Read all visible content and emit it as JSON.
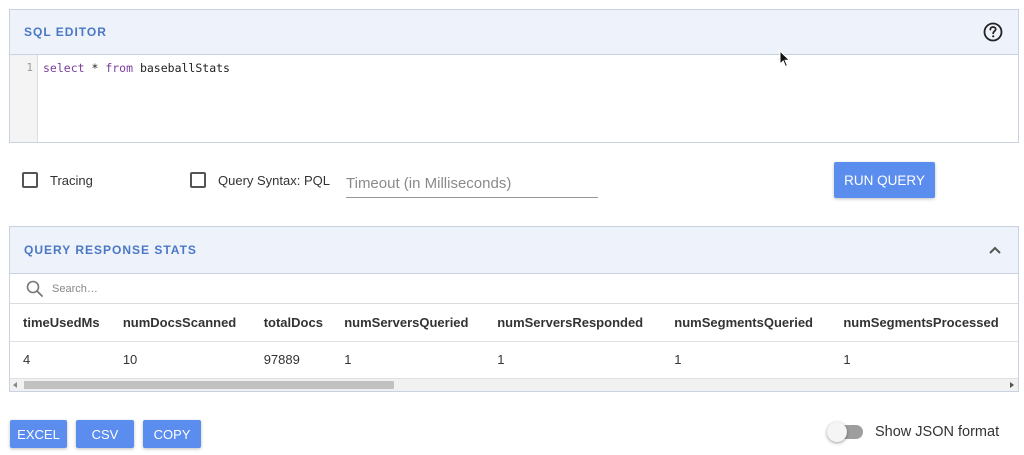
{
  "sql_editor": {
    "title": "SQL EDITOR",
    "help_icon": "help-circle-icon",
    "line_number": "1",
    "query_keyword_1": "select",
    "query_star": " * ",
    "query_keyword_2": "from",
    "query_table": " baseballStats"
  },
  "controls": {
    "tracing_label": "Tracing",
    "tracing_checked": false,
    "pql_label": "Query Syntax: PQL",
    "pql_checked": false,
    "timeout_placeholder": "Timeout (in Milliseconds)",
    "timeout_value": "",
    "run_label": "RUN QUERY"
  },
  "stats": {
    "title": "QUERY RESPONSE STATS",
    "collapse_icon": "chevron-up-icon",
    "search_placeholder": "Search…",
    "columns": [
      "timeUsedMs",
      "numDocsScanned",
      "totalDocs",
      "numServersQueried",
      "numServersResponded",
      "numSegmentsQueried",
      "numSegmentsProcessed"
    ],
    "rows": [
      [
        "4",
        "10",
        "97889",
        "1",
        "1",
        "1",
        "1"
      ]
    ]
  },
  "footer": {
    "excel_label": "EXCEL",
    "csv_label": "CSV",
    "copy_label": "COPY",
    "json_toggle_label": "Show JSON format",
    "json_toggle_on": false
  },
  "colors": {
    "accent": "#5b8def",
    "header_bg": "#eef2fa",
    "title_text": "#4a78c6"
  }
}
